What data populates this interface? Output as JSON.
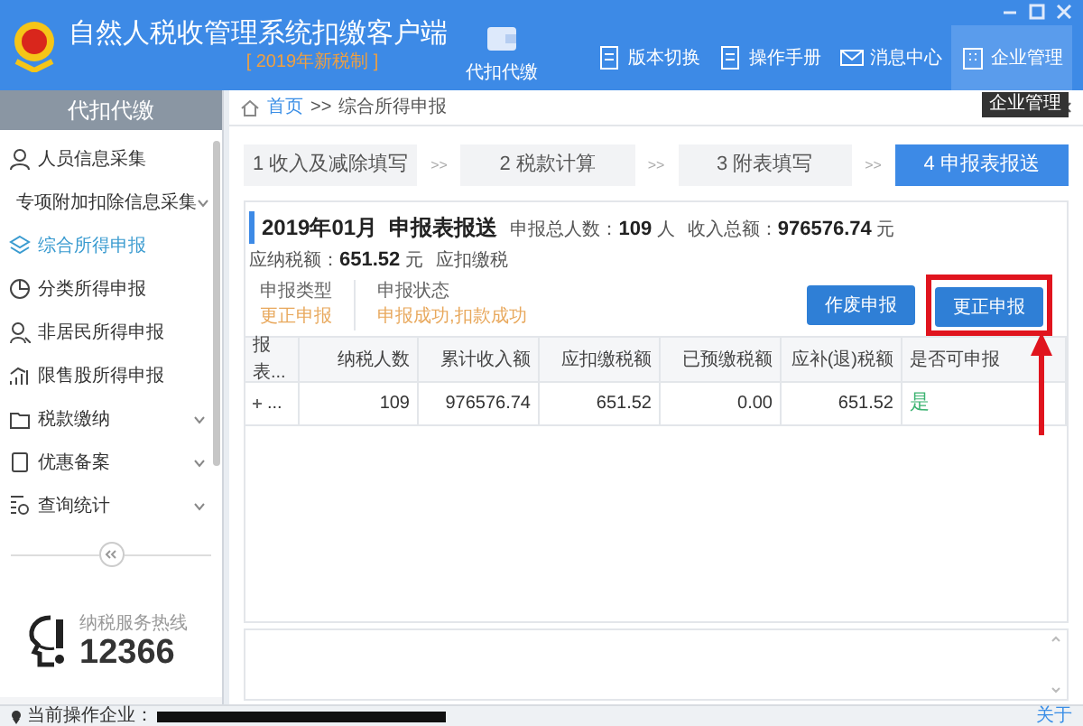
{
  "header": {
    "app_title": "自然人税收管理系统扣缴客户端",
    "edition": "[ 2019年新税制 ]",
    "module": "代扣代缴",
    "toolbar": [
      {
        "label": "版本切换",
        "selected": false
      },
      {
        "label": "操作手册",
        "selected": false
      },
      {
        "label": "消息中心",
        "selected": false
      },
      {
        "label": "企业管理",
        "selected": true
      }
    ],
    "tooltip": "企业管理"
  },
  "sidebar": {
    "title": "代扣代缴",
    "items": [
      {
        "label": "人员信息采集",
        "selected": false,
        "expandable": false
      },
      {
        "label": "专项附加扣除信息采集",
        "selected": false,
        "expandable": true
      },
      {
        "label": "综合所得申报",
        "selected": true,
        "expandable": false
      },
      {
        "label": "分类所得申报",
        "selected": false,
        "expandable": false
      },
      {
        "label": "非居民所得申报",
        "selected": false,
        "expandable": false
      },
      {
        "label": "限售股所得申报",
        "selected": false,
        "expandable": false
      },
      {
        "label": "税款缴纳",
        "selected": false,
        "expandable": true
      },
      {
        "label": "优惠备案",
        "selected": false,
        "expandable": true
      },
      {
        "label": "查询统计",
        "selected": false,
        "expandable": true
      }
    ],
    "hotline_label": "纳税服务热线",
    "hotline_number": "12366"
  },
  "breadcrumb": {
    "home": "首页",
    "separator": ">>",
    "current": "综合所得申报"
  },
  "steps": [
    {
      "label": "1 收入及减除填写",
      "selected": false
    },
    {
      "label": "2 税款计算",
      "selected": false
    },
    {
      "label": "3 附表填写",
      "selected": false
    },
    {
      "label": "4 申报表报送",
      "selected": true
    }
  ],
  "step_separator": ">>",
  "summary": {
    "title": "2019年01月  申报表报送",
    "stats": [
      "申报总人数：**109** 人",
      "收入总额：**976576.74** 元",
      "应纳税额：**651.52** 元",
      "应扣缴税"
    ],
    "fields": [
      {
        "label": "申报类型",
        "value": "更正申报"
      },
      {
        "label": "申报状态",
        "value": "申报成功,扣款成功"
      }
    ],
    "buttons": [
      "作废申报",
      "更正申报"
    ]
  },
  "table": {
    "columns": [
      "报表...",
      "纳税人数",
      "累计收入额",
      "应扣缴税额",
      "已预缴税额",
      "应补(退)税额",
      "是否可申报"
    ],
    "rows": [
      [
        "...",
        "109",
        "976576.74",
        "651.52",
        "0.00",
        "651.52",
        "是"
      ]
    ]
  },
  "status_bar": {
    "label": "当前操作企业：",
    "about": "关于"
  }
}
